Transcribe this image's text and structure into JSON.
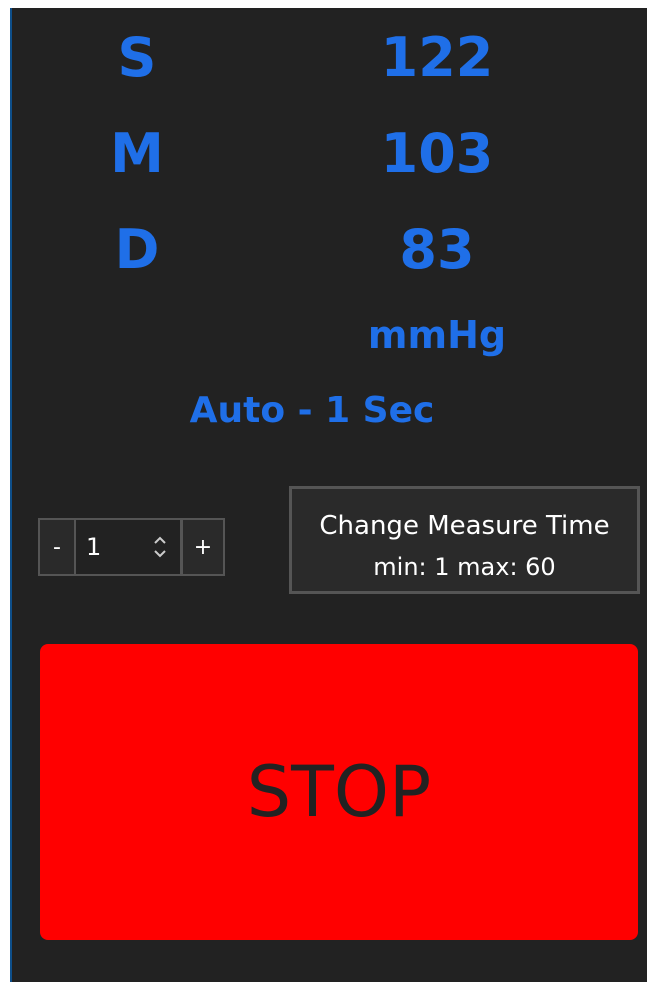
{
  "readings": [
    {
      "label": "S",
      "value": "122"
    },
    {
      "label": "M",
      "value": "103"
    },
    {
      "label": "D",
      "value": "83"
    }
  ],
  "unit": "mmHg",
  "mode": "Auto - 1 Sec",
  "stepper": {
    "minus_label": "-",
    "value": "1",
    "plus_label": "+"
  },
  "change_button": {
    "line1": "Change Measure Time",
    "line2": "min: 1 max: 60"
  },
  "stop_label": "STOP",
  "colors": {
    "background": "#222222",
    "reading_blue": "#1f6fe8",
    "stop_red": "#ff0000"
  }
}
